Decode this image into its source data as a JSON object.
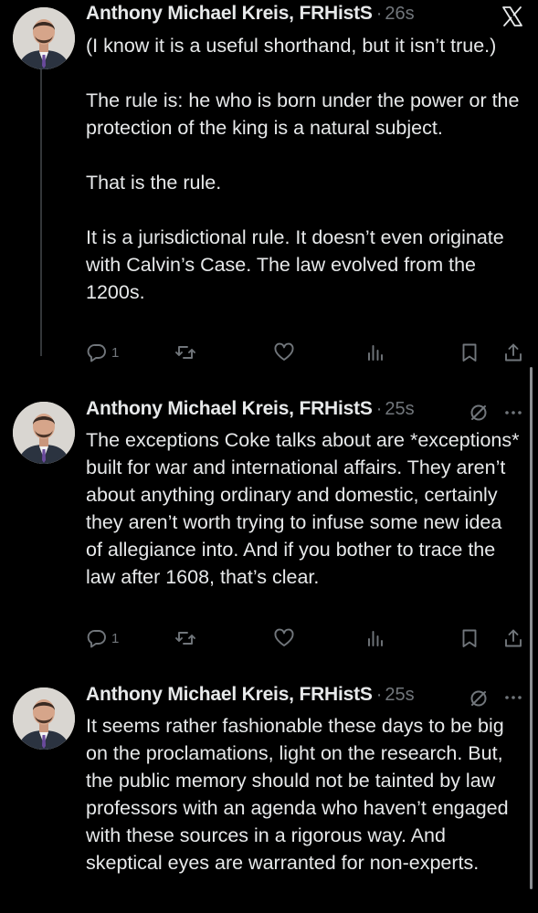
{
  "thread": [
    {
      "author": "Anthony Michael Kreis, FRHistS",
      "separator": "·",
      "time": "26s",
      "paragraphs": [
        "(I know it is a useful shorthand, but it isn’t true.)",
        "The rule is: he who is born under the power or the protection of the king is a natural subject.",
        "That is the rule.",
        "It is a jurisdictional rule. It doesn’t even originate with Calvin’s Case. The law evolved from the 1200s."
      ],
      "reply_count": "1"
    },
    {
      "author": "Anthony Michael Kreis, FRHistS",
      "separator": "·",
      "time": "25s",
      "paragraphs": [
        "The exceptions Coke talks about are *exceptions* built for war and international affairs. They aren’t about anything ordinary and domestic, certainly they aren’t worth trying to infuse some new idea of allegiance into. And if you bother to trace the law after 1608, that’s clear."
      ],
      "reply_count": "1"
    },
    {
      "author": "Anthony Michael Kreis, FRHistS",
      "separator": "·",
      "time": "25s",
      "paragraphs": [
        "It seems rather fashionable these days to be big on the proclamations, light on the research. But, the public memory should not be tainted by law professors with an agenda who haven’t engaged with these sources in a rigorous way. And skeptical eyes are warranted for non-experts."
      ]
    }
  ],
  "icons": {
    "close": "close-x-icon",
    "pending": "circle-slash-icon",
    "more": "more-dots-icon",
    "reply": "reply-icon",
    "repost": "repost-icon",
    "like": "heart-icon",
    "views": "analytics-icon",
    "bookmark": "bookmark-icon",
    "share": "share-icon"
  },
  "colors": {
    "background": "#000000",
    "text": "#e7e9ea",
    "muted": "#71767b",
    "thread_line": "#333639"
  }
}
